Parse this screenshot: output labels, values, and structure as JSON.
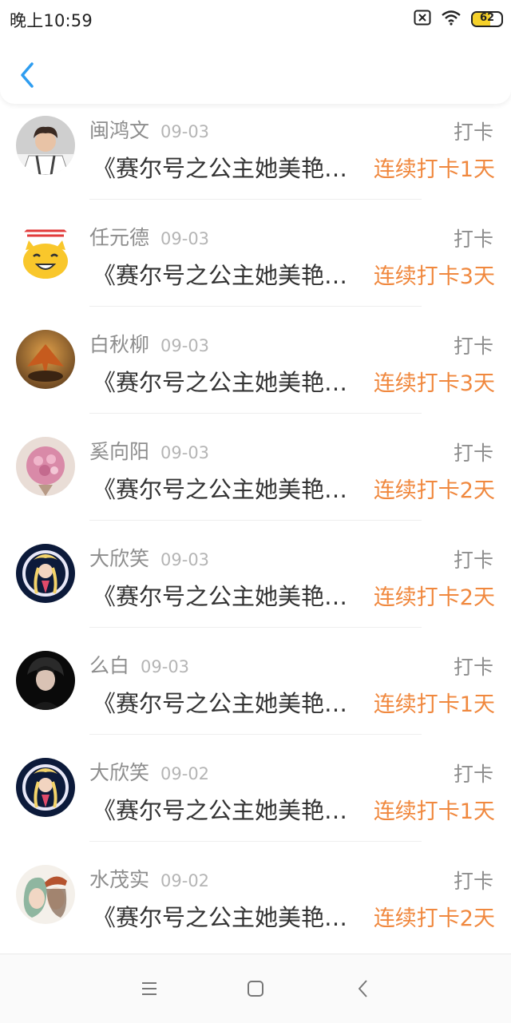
{
  "status_bar": {
    "time": "晚上10:59",
    "battery_level": "62",
    "battery_color": "#f5d12a",
    "icons": [
      "sim-off-icon",
      "wifi-icon",
      "battery-icon"
    ]
  },
  "header": {
    "back_icon": "chevron-left-icon",
    "accent_color": "#2e9df0"
  },
  "checkins": [
    {
      "name": "闽鸿文",
      "date": "09-03",
      "action": "打卡",
      "title": "《赛尔号之公主她美艳动人》",
      "streak": "连续打卡1天"
    },
    {
      "name": "任元德",
      "date": "09-03",
      "action": "打卡",
      "title": "《赛尔号之公主她美艳动人》",
      "streak": "连续打卡3天"
    },
    {
      "name": "白秋柳",
      "date": "09-03",
      "action": "打卡",
      "title": "《赛尔号之公主她美艳动人》",
      "streak": "连续打卡3天"
    },
    {
      "name": "奚向阳",
      "date": "09-03",
      "action": "打卡",
      "title": "《赛尔号之公主她美艳动人》",
      "streak": "连续打卡2天"
    },
    {
      "name": "大欣笑",
      "date": "09-03",
      "action": "打卡",
      "title": "《赛尔号之公主她美艳动人》",
      "streak": "连续打卡2天"
    },
    {
      "name": "么白",
      "date": "09-03",
      "action": "打卡",
      "title": "《赛尔号之公主她美艳动人》",
      "streak": "连续打卡1天"
    },
    {
      "name": "大欣笑",
      "date": "09-02",
      "action": "打卡",
      "title": "《赛尔号之公主她美艳动人》",
      "streak": "连续打卡1天"
    },
    {
      "name": "水茂实",
      "date": "09-02",
      "action": "打卡",
      "title": "《赛尔号之公主她美艳动人》",
      "streak": "连续打卡2天"
    }
  ],
  "colors": {
    "streak": "#f0883e",
    "name": "#8d8d8d",
    "title": "#333333"
  },
  "nav_bar": {
    "icons": [
      "menu-icon",
      "home-square-icon",
      "back-triangle-icon"
    ]
  }
}
